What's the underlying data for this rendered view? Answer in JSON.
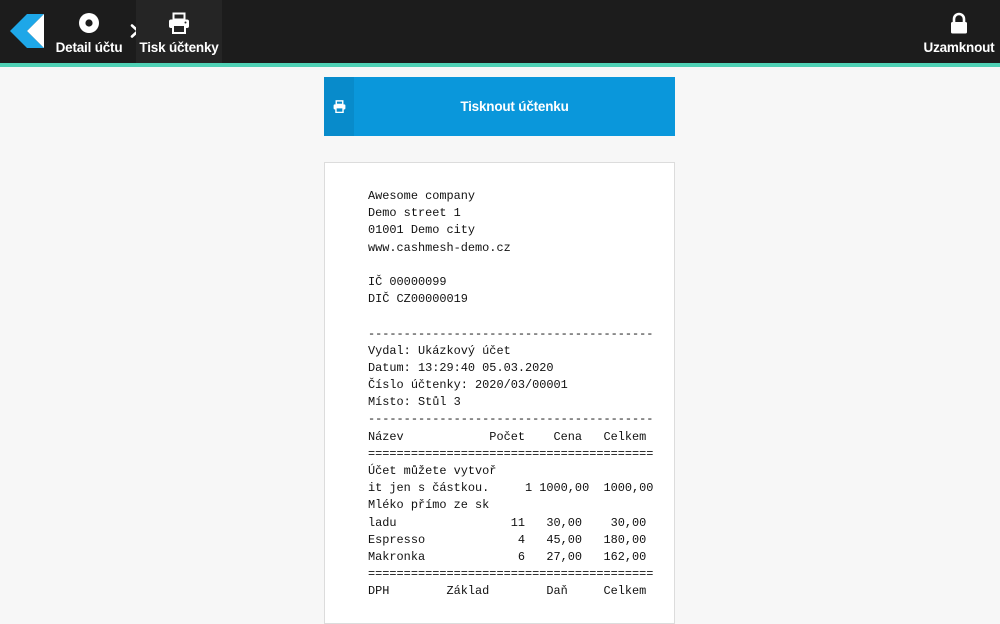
{
  "colors": {
    "topbar": "#1c1c1c",
    "accent_stripe": "#4fd1b5",
    "primary_button": "#0a97db",
    "logo_blue": "#1ea7e8",
    "logo_white": "#ffffff"
  },
  "header": {
    "breadcrumb": [
      {
        "label": "Detail účtu",
        "icon": "disc-icon"
      },
      {
        "label": "Tisk účtenky",
        "icon": "printer-icon"
      }
    ],
    "separator_icon": "chevron-right-icon",
    "lock": {
      "label": "Uzamknout",
      "icon": "lock-icon"
    }
  },
  "print_button": {
    "label": "Tisknout účtenku",
    "icon": "printer-icon"
  },
  "receipt": {
    "lines": [
      "Awesome company",
      "Demo street 1",
      "01001 Demo city",
      "www.cashmesh-demo.cz",
      "",
      "IČ 00000099",
      "DIČ CZ00000019",
      "",
      "----------------------------------------",
      "Vydal: Ukázkový účet",
      "Datum: 13:29:40 05.03.2020",
      "Číslo účtenky: 2020/03/00001",
      "Místo: Stůl 3",
      "----------------------------------------",
      "Název            Počet    Cena   Celkem",
      "========================================",
      "Účet můžete vytvoř",
      "it jen s částkou.     1 1000,00  1000,00",
      "Mléko přímo ze sk",
      "ladu                11   30,00    30,00",
      "Espresso             4   45,00   180,00",
      "Makronka             6   27,00   162,00",
      "========================================",
      "DPH        Základ        Daň     Celkem"
    ]
  }
}
